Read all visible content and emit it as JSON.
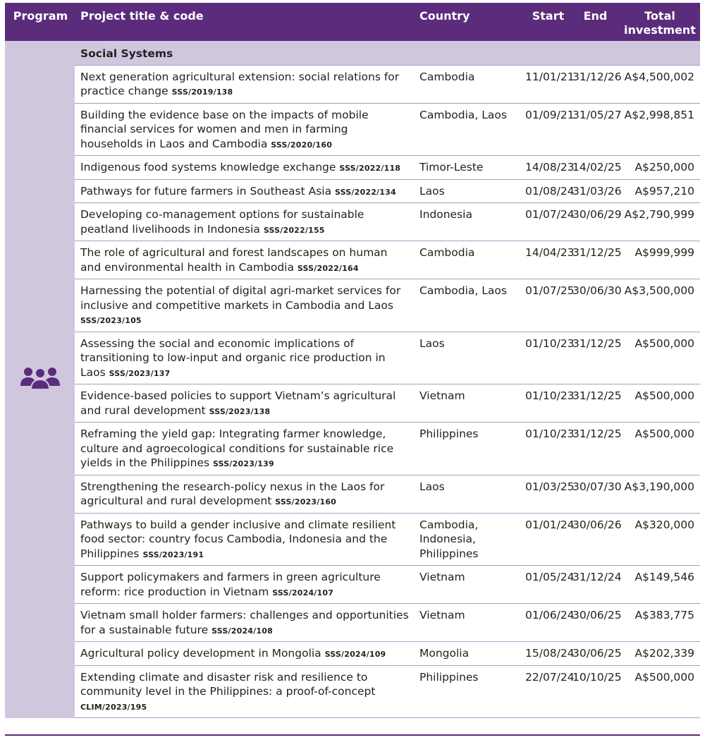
{
  "headers": {
    "program": "Program",
    "project": "Project title & code",
    "country": "Country",
    "start": "Start",
    "end": "End",
    "investment": "Total investment"
  },
  "program_icon": "people-group-icon",
  "colors": {
    "header_bg": "#5b2c7c",
    "section_bg": "#d0c7de",
    "row_rule": "#b595c8"
  },
  "section_title": "Social Systems",
  "rows": [
    {
      "title": "Next generation agricultural extension: social relations for practice change",
      "code": "SSS/2019/138",
      "country": "Cambodia",
      "start": "11/01/21",
      "end": "31/12/26",
      "investment": "A$4,500,002"
    },
    {
      "title": "Building the evidence base on the impacts of mobile financial services for women and men in farming households in Laos and Cambodia",
      "code": "SSS/2020/160",
      "country": "Cambodia, Laos",
      "start": "01/09/21",
      "end": "31/05/27",
      "investment": "A$2,998,851"
    },
    {
      "title": "Indigenous food systems knowledge exchange",
      "code": "SSS/2022/118",
      "country": "Timor-Leste",
      "start": "14/08/23",
      "end": "14/02/25",
      "investment": "A$250,000"
    },
    {
      "title": "Pathways for future farmers in Southeast Asia",
      "code": "SSS/2022/134",
      "country": "Laos",
      "start": "01/08/24",
      "end": "31/03/26",
      "investment": "A$957,210"
    },
    {
      "title": "Developing co-management options for sustainable peatland livelihoods in Indonesia",
      "code": "SSS/2022/155",
      "country": "Indonesia",
      "start": "01/07/24",
      "end": "30/06/29",
      "investment": "A$2,790,999"
    },
    {
      "title": "The role of agricultural and forest landscapes on human and environmental health in Cambodia",
      "code": "SSS/2022/164",
      "country": "Cambodia",
      "start": "14/04/23",
      "end": "31/12/25",
      "investment": "A$999,999"
    },
    {
      "title": "Harnessing the potential of digital agri-market services for inclusive and competitive markets in Cambodia and Laos",
      "code": "SSS/2023/105",
      "country": "Cambodia, Laos",
      "start": "01/07/25",
      "end": "30/06/30",
      "investment": "A$3,500,000"
    },
    {
      "title": "Assessing the social and economic implications of transitioning to low-input and organic rice production in Laos",
      "code": "SSS/2023/137",
      "country": "Laos",
      "start": "01/10/23",
      "end": "31/12/25",
      "investment": "A$500,000"
    },
    {
      "title": "Evidence-based policies to support Vietnam’s agricultural and rural development",
      "code": "SSS/2023/138",
      "country": "Vietnam",
      "start": "01/10/23",
      "end": "31/12/25",
      "investment": "A$500,000"
    },
    {
      "title": "Reframing the yield gap: Integrating farmer knowledge, culture and agroecological conditions for sustainable rice yields in the Philippines",
      "code": "SSS/2023/139",
      "country": "Philippines",
      "start": "01/10/23",
      "end": "31/12/25",
      "investment": "A$500,000"
    },
    {
      "title": "Strengthening the research-policy nexus in the Laos for agricultural and rural development",
      "code": "SSS/2023/160",
      "country": "Laos",
      "start": "01/03/25",
      "end": "30/07/30",
      "investment": "A$3,190,000"
    },
    {
      "title": "Pathways to build a gender inclusive and climate resilient food sector: country focus Cambodia, Indonesia and the Philippines",
      "code": "SSS/2023/191",
      "country": "Cambodia, Indonesia, Philippines",
      "start": "01/01/24",
      "end": "30/06/26",
      "investment": "A$320,000"
    },
    {
      "title": "Support policymakers and farmers in green agriculture reform: rice production in Vietnam",
      "code": "SSS/2024/107",
      "country": "Vietnam",
      "start": "01/05/24",
      "end": "31/12/24",
      "investment": "A$149,546"
    },
    {
      "title": "Vietnam small holder farmers: challenges and opportunities for a sustainable future",
      "code": "SSS/2024/108",
      "country": "Vietnam",
      "start": "01/06/24",
      "end": "30/06/25",
      "investment": "A$383,775"
    },
    {
      "title": "Agricultural policy development in Mongolia",
      "code": "SSS/2024/109",
      "country": "Mongolia",
      "start": "15/08/24",
      "end": "30/06/25",
      "investment": "A$202,339"
    },
    {
      "title": "Extending climate and disaster risk and resilience to community level in the Philippines: a proof-of-concept",
      "code": "CLIM/2023/195",
      "country": "Philippines",
      "start": "22/07/24",
      "end": "10/10/25",
      "investment": "A$500,000"
    }
  ]
}
